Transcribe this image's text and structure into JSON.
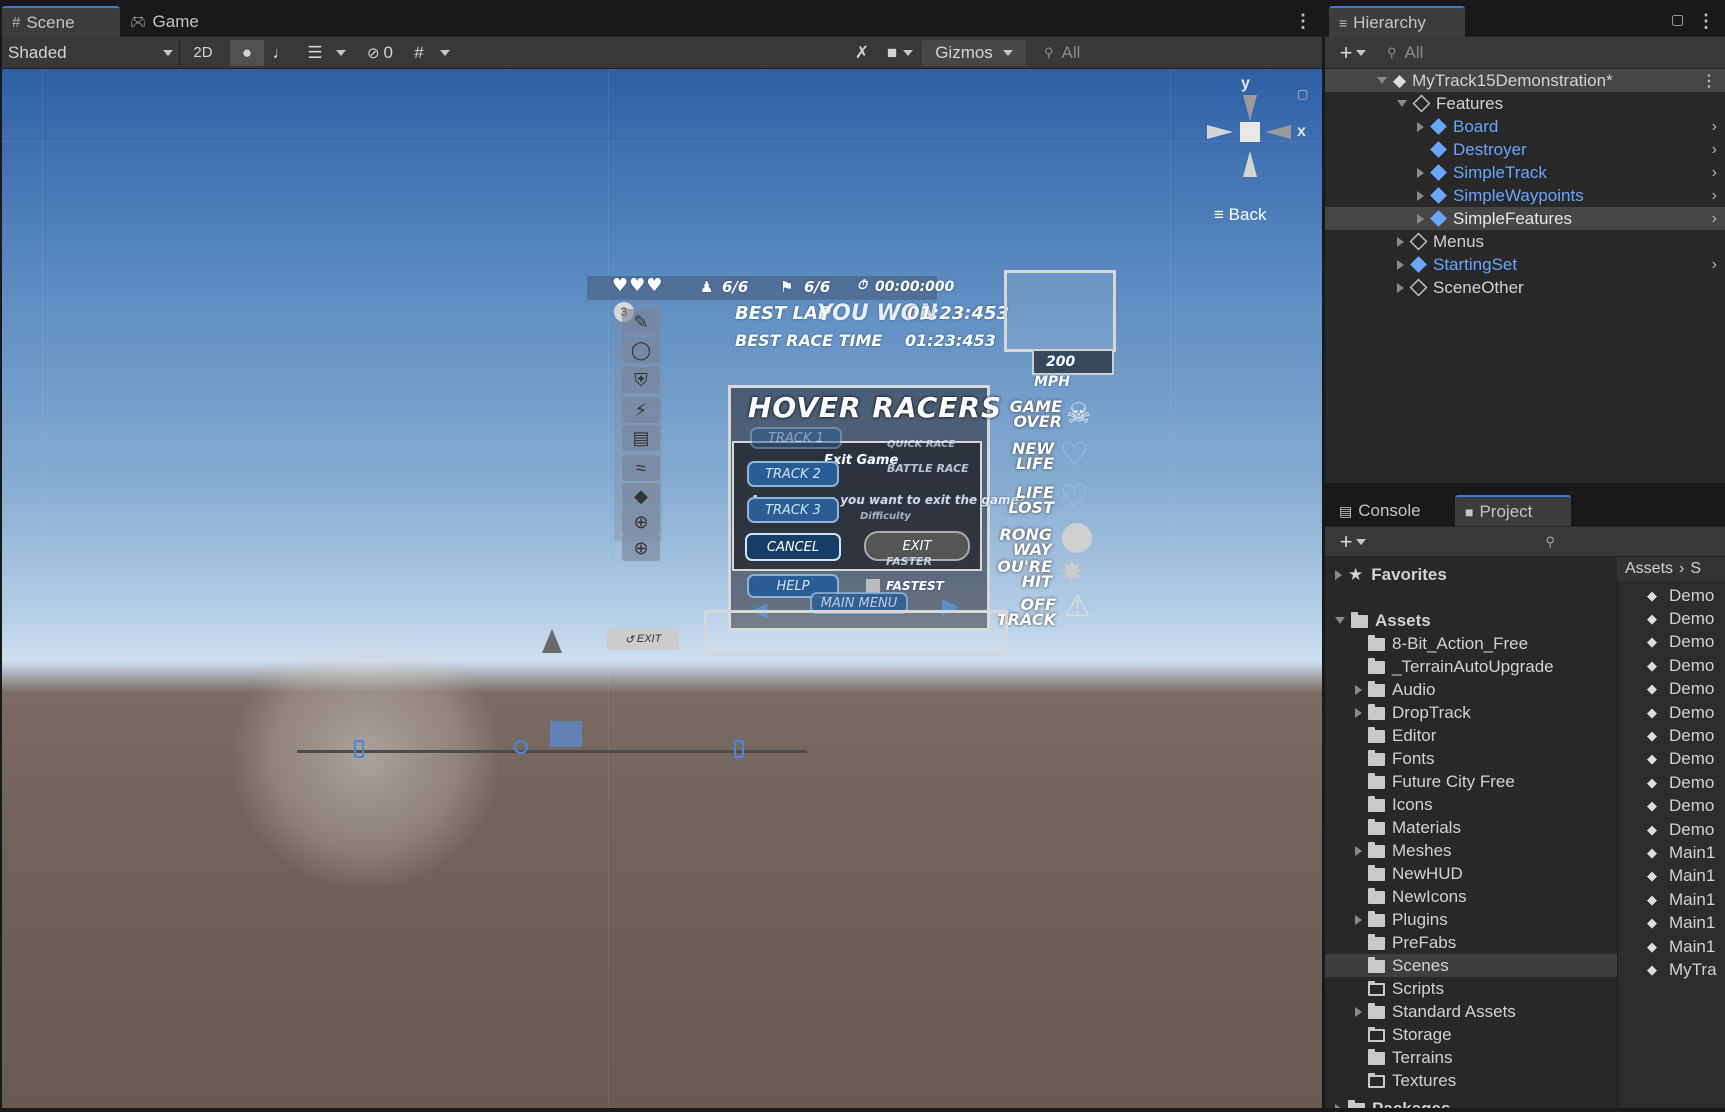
{
  "scene_tabs": {
    "scene": "Scene",
    "game": "Game"
  },
  "scene_toolbar": {
    "shading_mode": "Shaded",
    "mode_2d": "2D",
    "hidden_count": "0",
    "gizmos": "Gizmos",
    "search_placeholder": "All"
  },
  "gizmo": {
    "y": "y",
    "x": "x",
    "view_label": "Back"
  },
  "hud": {
    "lap_stat": "6/6",
    "position_stat": "6/6",
    "timer": "00:00:000",
    "best_lap": "BEST LAP",
    "best_time": "01:23:453",
    "overlay_text": "YOU WON",
    "secondary_line": "BEST RACE TIME",
    "secondary_time": "01:23:453",
    "title": "HOVER RACERS",
    "exit_game": "Exit Game",
    "quick_race": "QUICK RACE",
    "battle_race": "BATTLE RACE",
    "question": "Are you sure you want to exit the game?",
    "difficulty": "Difficulty",
    "track1": "TRACK 1",
    "track2": "TRACK 2",
    "track3": "TRACK 3",
    "cancel": "CANCEL",
    "exit": "EXIT",
    "faster": "FASTER",
    "fastest": "FASTEST",
    "help": "HELP",
    "main_menu": "MAIN MENU",
    "speed": "200 MPH",
    "small_exit": "EXIT",
    "lives_badge": "3",
    "game_over": "GAME\nOVER",
    "new_life": "NEW\nLIFE",
    "life_lost": "LIFE\nLOST",
    "wrong_way": "RONG\nWAY",
    "youre_hit": "OU'RE\nHIT",
    "off_track": "OFF\nTRACK"
  },
  "hierarchy": {
    "tab": "Hierarchy",
    "search_placeholder": "All",
    "root": "MyTrack15Demonstration*",
    "items": [
      {
        "label": "Features"
      },
      {
        "label": "Board"
      },
      {
        "label": "Destroyer"
      },
      {
        "label": "SimpleTrack"
      },
      {
        "label": "SimpleWaypoints"
      },
      {
        "label": "SimpleFeatures"
      },
      {
        "label": "Menus"
      },
      {
        "label": "StartingSet"
      },
      {
        "label": "SceneOther"
      }
    ]
  },
  "project": {
    "tab_console": "Console",
    "tab_project": "Project",
    "favorites": "Favorites",
    "assets_root": "Assets",
    "breadcrumb": "Assets",
    "breadcrumb_next": "S",
    "folders": [
      "8-Bit_Action_Free",
      "_TerrainAutoUpgrade",
      "Audio",
      "DropTrack",
      "Editor",
      "Fonts",
      "Future City Free",
      "Icons",
      "Materials",
      "Meshes",
      "NewHUD",
      "NewIcons",
      "Plugins",
      "PreFabs",
      "Scenes",
      "Scripts",
      "Standard Assets",
      "Storage",
      "Terrains",
      "Textures"
    ],
    "packages": "Packages",
    "scene_files": [
      "Demo",
      "Demo",
      "Demo",
      "Demo",
      "Demo",
      "Demo",
      "Demo",
      "Demo",
      "Demo",
      "Demo",
      "Demo",
      "Main1",
      "Main1",
      "Main1",
      "Main1",
      "Main1",
      "MyTra"
    ]
  },
  "colors": {
    "prefab_blue": "#6aa5ff",
    "selection": "#464646",
    "panel_bg": "#282828",
    "accent_tab": "#3a79d8"
  }
}
